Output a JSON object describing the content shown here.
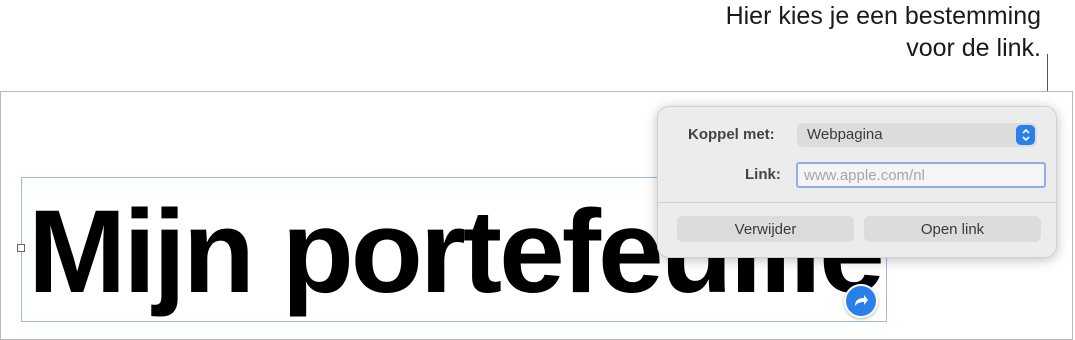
{
  "callout": {
    "line1": "Hier kies je een bestemming",
    "line2": "voor de link."
  },
  "document": {
    "headline": "Mijn portefeuille"
  },
  "popover": {
    "link_to_label": "Koppel met:",
    "link_to_value": "Webpagina",
    "link_label": "Link:",
    "link_placeholder": "www.apple.com/nl",
    "remove_button": "Verwijder",
    "open_button": "Open link"
  },
  "colors": {
    "accent": "#2b7fe8",
    "popover_bg": "#ececec",
    "selection_border": "#9fb9e2"
  },
  "icons": {
    "link_badge": "link-arrow-icon",
    "select_stepper": "chevron-updown-icon"
  }
}
